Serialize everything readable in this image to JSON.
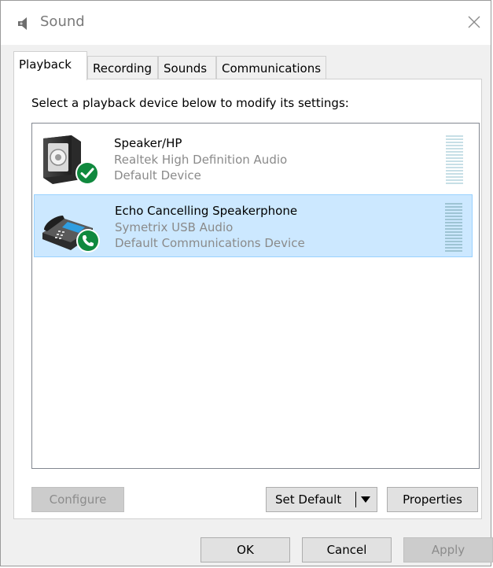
{
  "window": {
    "title": "Sound",
    "icon": "speaker-icon"
  },
  "tabs": [
    {
      "label": "Playback",
      "active": true
    },
    {
      "label": "Recording",
      "active": false
    },
    {
      "label": "Sounds",
      "active": false
    },
    {
      "label": "Communications",
      "active": false
    }
  ],
  "panel": {
    "instruction": "Select a playback device below to modify its settings:"
  },
  "devices": [
    {
      "name": "Speaker/HP",
      "driver": "Realtek High Definition Audio",
      "status": "Default Device",
      "icon": "speaker-device-icon",
      "badge": "checkmark-badge-icon",
      "selected": false
    },
    {
      "name": "Echo Cancelling Speakerphone",
      "driver": "Symetrix USB Audio",
      "status": "Default Communications Device",
      "icon": "phone-device-icon",
      "badge": "phone-badge-icon",
      "selected": true
    }
  ],
  "buttons": {
    "configure": "Configure",
    "set_default": "Set Default",
    "properties": "Properties",
    "ok": "OK",
    "cancel": "Cancel",
    "apply": "Apply"
  },
  "colors": {
    "selection_bg": "#cce8ff",
    "selection_border": "#99d1ff",
    "badge_green": "#10893e"
  }
}
